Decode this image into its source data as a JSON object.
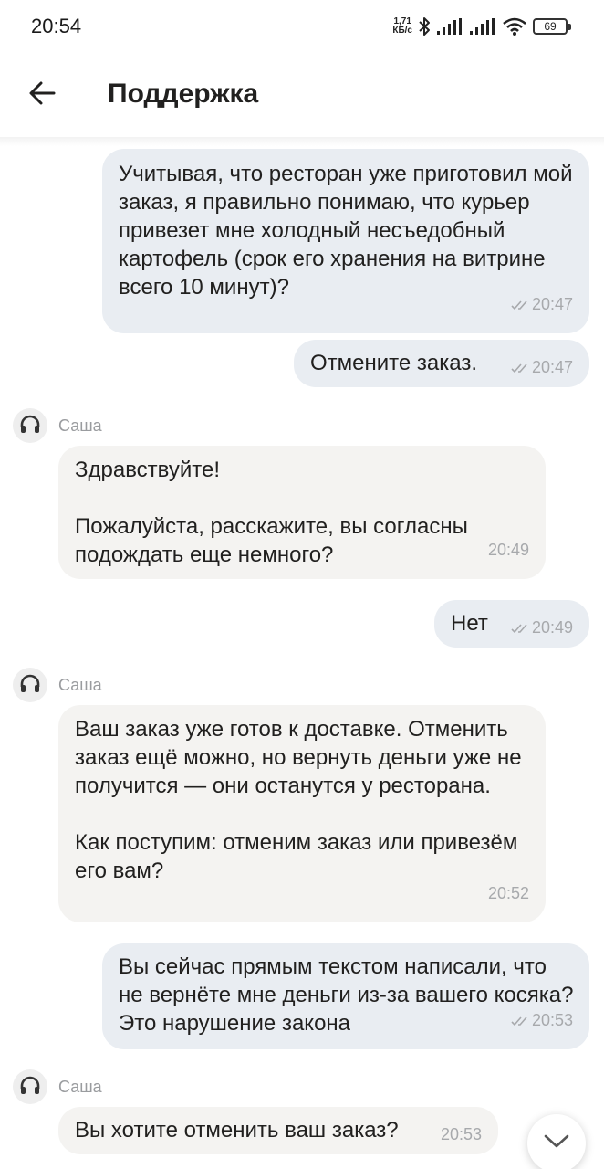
{
  "status_bar": {
    "time": "20:54",
    "net_speed_value": "1,71",
    "net_speed_unit": "КБ/с",
    "battery": "69"
  },
  "header": {
    "title": "Поддержка"
  },
  "messages": [
    {
      "direction": "out",
      "text": "Учитывая, что ресторан уже приготовил мой заказ, я правильно понимаю, что курьер привезет мне холодный несъедобный картофель (срок его хранения на витрине всего 10 минут)?",
      "time": "20:47"
    },
    {
      "direction": "out",
      "text": "Отмените заказ.",
      "time": "20:47"
    },
    {
      "direction": "in",
      "sender": "Саша",
      "text": "Здравствуйте!\n\nПожалуйста, расскажите, вы согласны подождать еще немного?",
      "time": "20:49"
    },
    {
      "direction": "out",
      "text": "Нет",
      "time": "20:49"
    },
    {
      "direction": "in",
      "sender": "Саша",
      "text": "Ваш заказ уже готов к доставке. Отменить заказ ещё можно, но вернуть деньги уже не получится — они останутся у ресторана.\n\nКак поступим: отменим заказ или привезём его вам?",
      "time": "20:52"
    },
    {
      "direction": "out",
      "text": "Вы сейчас прямым текстом написали, что не вернёте мне деньги из-за вашего косяка? Это нарушение закона",
      "time": "20:53"
    },
    {
      "direction": "in",
      "sender": "Саша",
      "text": "Вы хотите отменить ваш заказ?",
      "time": "20:53"
    }
  ],
  "colors": {
    "outgoing_bubble": "#e9edf2",
    "incoming_bubble": "#f4f3f1",
    "meta_text": "#a7a9ac"
  },
  "icons": {
    "back": "arrow-left-icon",
    "avatar": "headset-icon",
    "read_status": "double-check-icon",
    "scroll_down": "chevron-down-icon"
  }
}
